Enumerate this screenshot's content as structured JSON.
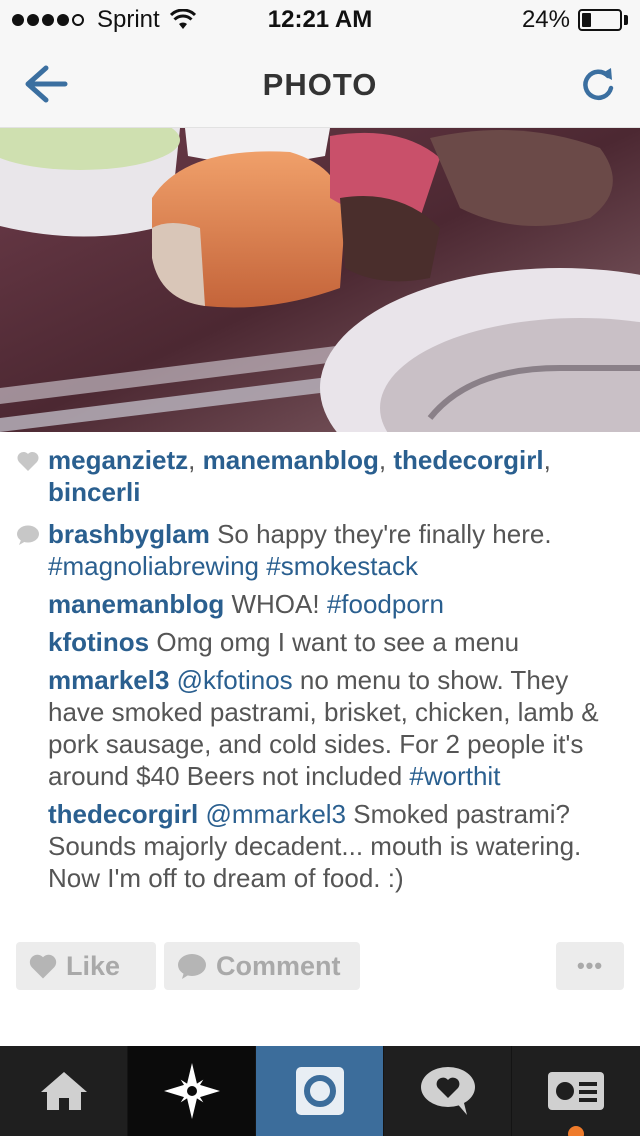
{
  "status_bar": {
    "carrier": "Sprint",
    "time": "12:21 AM",
    "battery_percent_label": "24%",
    "battery_level": 0.24
  },
  "nav": {
    "title": "PHOTO",
    "back_icon": "back-arrow-icon",
    "refresh_icon": "refresh-icon"
  },
  "likes": {
    "users": [
      "meganzietz",
      "manemanblog",
      "thedecorgirl",
      "bincerli"
    ]
  },
  "comments": [
    {
      "user": "brashbyglam",
      "parts": [
        {
          "t": "text",
          "v": "So happy they're finally here. "
        },
        {
          "t": "tag",
          "v": "#magnoliabrewing"
        },
        {
          "t": "text",
          "v": " "
        },
        {
          "t": "tag",
          "v": "#smokestack"
        }
      ]
    },
    {
      "user": "manemanblog",
      "parts": [
        {
          "t": "text",
          "v": "WHOA! "
        },
        {
          "t": "tag",
          "v": "#foodporn"
        }
      ]
    },
    {
      "user": "kfotinos",
      "parts": [
        {
          "t": "text",
          "v": "Omg omg I want to see a menu"
        }
      ]
    },
    {
      "user": "mmarkel3",
      "parts": [
        {
          "t": "tag",
          "v": "@kfotinos"
        },
        {
          "t": "text",
          "v": " no menu to show. They have smoked pastrami, brisket, chicken, lamb & pork sausage, and cold sides. For 2 people it's around $40 Beers not included "
        },
        {
          "t": "tag",
          "v": "#worthit"
        }
      ]
    },
    {
      "user": "thedecorgirl",
      "parts": [
        {
          "t": "tag",
          "v": "@mmarkel3"
        },
        {
          "t": "text",
          "v": " Smoked pastrami? Sounds majorly decadent... mouth is watering.  Now I'm off to dream of food. :)"
        }
      ]
    }
  ],
  "actions": {
    "like_label": "Like",
    "comment_label": "Comment",
    "more_label": "•••"
  },
  "tab_bar": {
    "tabs": [
      {
        "name": "home",
        "icon": "home-icon"
      },
      {
        "name": "explore",
        "icon": "explore-star-icon"
      },
      {
        "name": "camera",
        "icon": "camera-icon"
      },
      {
        "name": "news",
        "icon": "heart-bubble-icon"
      },
      {
        "name": "profile",
        "icon": "profile-card-icon"
      }
    ]
  },
  "colors": {
    "link": "#2a5f8f",
    "accent_blue": "#3c6d9b",
    "notification": "#ef7b2b"
  }
}
